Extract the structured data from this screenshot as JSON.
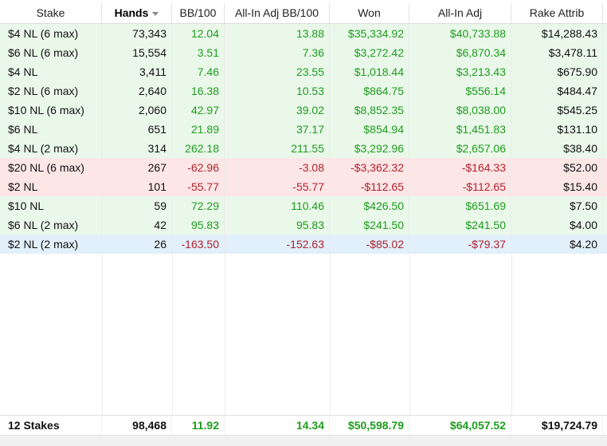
{
  "columns": [
    {
      "label": "Stake"
    },
    {
      "label": "Hands",
      "sorted": true
    },
    {
      "label": "BB/100"
    },
    {
      "label": "All-In Adj BB/100"
    },
    {
      "label": "Won"
    },
    {
      "label": "All-In Adj"
    },
    {
      "label": "Rake Attrib"
    }
  ],
  "rows": [
    {
      "stake": "$4 NL (6 max)",
      "hands": "73,343",
      "bb100": "12.04",
      "adj_bb100": "13.88",
      "won": "$35,334.92",
      "adj": "$40,733.88",
      "rake": "$14,288.43",
      "tone": "pos",
      "bb_tone": "g",
      "adjbb_tone": "g",
      "won_tone": "g",
      "adj_tone": "g"
    },
    {
      "stake": "$6 NL (6 max)",
      "hands": "15,554",
      "bb100": "3.51",
      "adj_bb100": "7.36",
      "won": "$3,272.42",
      "adj": "$6,870.34",
      "rake": "$3,478.11",
      "tone": "pos",
      "bb_tone": "g",
      "adjbb_tone": "g",
      "won_tone": "g",
      "adj_tone": "g"
    },
    {
      "stake": "$4 NL",
      "hands": "3,411",
      "bb100": "7.46",
      "adj_bb100": "23.55",
      "won": "$1,018.44",
      "adj": "$3,213.43",
      "rake": "$675.90",
      "tone": "pos",
      "bb_tone": "g",
      "adjbb_tone": "g",
      "won_tone": "g",
      "adj_tone": "g"
    },
    {
      "stake": "$2 NL (6 max)",
      "hands": "2,640",
      "bb100": "16.38",
      "adj_bb100": "10.53",
      "won": "$864.75",
      "adj": "$556.14",
      "rake": "$484.47",
      "tone": "pos",
      "bb_tone": "g",
      "adjbb_tone": "g",
      "won_tone": "g",
      "adj_tone": "g"
    },
    {
      "stake": "$10 NL (6 max)",
      "hands": "2,060",
      "bb100": "42.97",
      "adj_bb100": "39.02",
      "won": "$8,852.35",
      "adj": "$8,038.00",
      "rake": "$545.25",
      "tone": "pos",
      "bb_tone": "g",
      "adjbb_tone": "g",
      "won_tone": "g",
      "adj_tone": "g"
    },
    {
      "stake": "$6 NL",
      "hands": "651",
      "bb100": "21.89",
      "adj_bb100": "37.17",
      "won": "$854.94",
      "adj": "$1,451.83",
      "rake": "$131.10",
      "tone": "pos",
      "bb_tone": "g",
      "adjbb_tone": "g",
      "won_tone": "g",
      "adj_tone": "g"
    },
    {
      "stake": "$4 NL (2 max)",
      "hands": "314",
      "bb100": "262.18",
      "adj_bb100": "211.55",
      "won": "$3,292.96",
      "adj": "$2,657.06",
      "rake": "$38.40",
      "tone": "pos",
      "bb_tone": "g",
      "adjbb_tone": "g",
      "won_tone": "g",
      "adj_tone": "g"
    },
    {
      "stake": "$20 NL (6 max)",
      "hands": "267",
      "bb100": "-62.96",
      "adj_bb100": "-3.08",
      "won": "-$3,362.32",
      "adj": "-$164.33",
      "rake": "$52.00",
      "tone": "neg",
      "bb_tone": "r",
      "adjbb_tone": "r",
      "won_tone": "r",
      "adj_tone": "r"
    },
    {
      "stake": "$2 NL",
      "hands": "101",
      "bb100": "-55.77",
      "adj_bb100": "-55.77",
      "won": "-$112.65",
      "adj": "-$112.65",
      "rake": "$15.40",
      "tone": "neg",
      "bb_tone": "r",
      "adjbb_tone": "r",
      "won_tone": "r",
      "adj_tone": "r"
    },
    {
      "stake": "$10 NL",
      "hands": "59",
      "bb100": "72.29",
      "adj_bb100": "110.46",
      "won": "$426.50",
      "adj": "$651.69",
      "rake": "$7.50",
      "tone": "pos",
      "bb_tone": "g",
      "adjbb_tone": "g",
      "won_tone": "g",
      "adj_tone": "g"
    },
    {
      "stake": "$6 NL (2 max)",
      "hands": "42",
      "bb100": "95.83",
      "adj_bb100": "95.83",
      "won": "$241.50",
      "adj": "$241.50",
      "rake": "$4.00",
      "tone": "pos",
      "bb_tone": "g",
      "adjbb_tone": "g",
      "won_tone": "g",
      "adj_tone": "g"
    },
    {
      "stake": "$2 NL (2 max)",
      "hands": "26",
      "bb100": "-163.50",
      "adj_bb100": "-152.63",
      "won": "-$85.02",
      "adj": "-$79.37",
      "rake": "$4.20",
      "tone": "sel",
      "bb_tone": "r",
      "adjbb_tone": "r",
      "won_tone": "r",
      "adj_tone": "r"
    }
  ],
  "footer": {
    "stake": "12 Stakes",
    "hands": "98,468",
    "bb100": "11.92",
    "adj_bb100": "14.34",
    "won": "$50,598.79",
    "adj": "$64,057.52",
    "rake": "$19,724.79"
  },
  "colors": {
    "positive_text": "#1e9c1e",
    "negative_text": "#b0222e",
    "positive_row": "#eaf8ea",
    "negative_row": "#fde6e6",
    "selected_row": "#e2f0fb"
  }
}
